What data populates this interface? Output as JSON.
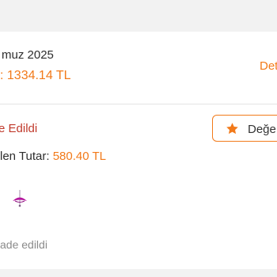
{
  "order": {
    "date": "muz 2025",
    "total": ": 1334.14 TL",
    "details_label": "Det"
  },
  "shipment": {
    "status": "e Edildi",
    "refund_label": "len Tutar: ",
    "refund_amount": "580.40 TL",
    "review_button_label": "Değe",
    "product_image": "umbrella-product-image",
    "bottom_status": "ade edildi"
  },
  "colors": {
    "accent": "#f27a1a",
    "status_red": "#c0392b",
    "muted_text": "#8a8a8a",
    "product_magenta": "#b5179e"
  }
}
